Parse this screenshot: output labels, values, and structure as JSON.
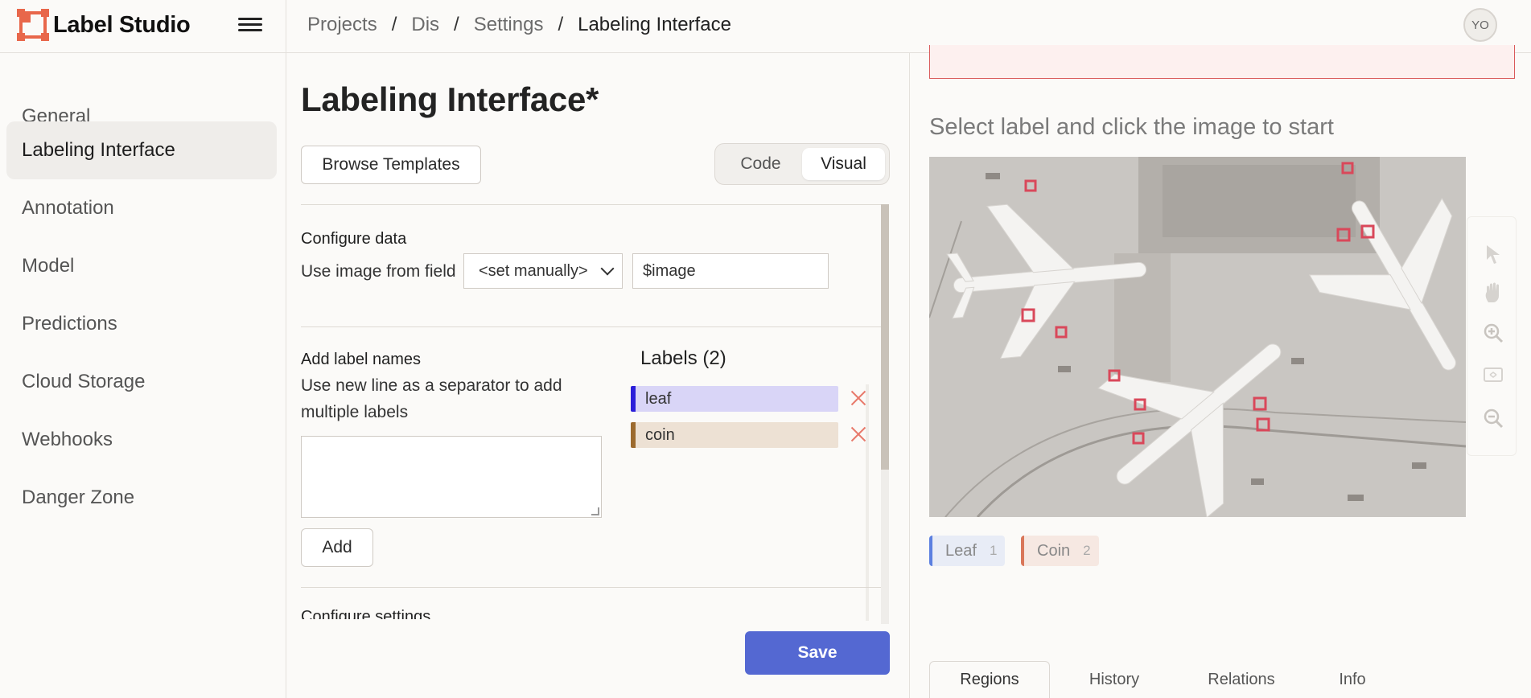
{
  "app": {
    "name": "Label Studio"
  },
  "breadcrumb": {
    "items": [
      "Projects",
      "Dis",
      "Settings",
      "Labeling Interface"
    ],
    "separator": "/"
  },
  "user": {
    "initials": "YO"
  },
  "sidebar": {
    "items": [
      {
        "label": "General",
        "active": false
      },
      {
        "label": "Labeling Interface",
        "active": true
      },
      {
        "label": "Annotation",
        "active": false
      },
      {
        "label": "Model",
        "active": false
      },
      {
        "label": "Predictions",
        "active": false
      },
      {
        "label": "Cloud Storage",
        "active": false
      },
      {
        "label": "Webhooks",
        "active": false
      },
      {
        "label": "Danger Zone",
        "active": false
      }
    ]
  },
  "config": {
    "title": "Labeling Interface*",
    "browse_templates": "Browse Templates",
    "mode_toggle": {
      "code": "Code",
      "visual": "Visual",
      "selected": "Visual"
    },
    "configure_data": {
      "title": "Configure data",
      "field_label": "Use image from field",
      "select_value": "<set manually>",
      "input_value": "$image"
    },
    "add_labels": {
      "title": "Add label names",
      "hint": "Use new line as a separator to add multiple labels",
      "textarea_value": "",
      "add_button": "Add"
    },
    "labels": {
      "title": "Labels (2)",
      "items": [
        {
          "name": "leaf",
          "color": "#2b1fd9",
          "bg": "#d9d5f7"
        },
        {
          "name": "coin",
          "color": "#9c6a2e",
          "bg": "#ede1d4"
        }
      ]
    },
    "next_section_partial": "Configure settings",
    "save": "Save"
  },
  "preview": {
    "hint": "Select label and click the image to start",
    "tools": [
      "pointer-icon",
      "hand-icon",
      "zoom-in-icon",
      "fit-icon",
      "zoom-out-icon"
    ],
    "chips": [
      {
        "label": "Leaf",
        "count": "1",
        "color": "#5b7fe0",
        "bg": "#e8ecf6"
      },
      {
        "label": "Coin",
        "count": "2",
        "color": "#d9775a",
        "bg": "#f6e8e2"
      }
    ],
    "tabs": [
      {
        "label": "Regions",
        "active": true
      },
      {
        "label": "History",
        "active": false
      },
      {
        "label": "Relations",
        "active": false
      },
      {
        "label": "Info",
        "active": false
      }
    ]
  }
}
